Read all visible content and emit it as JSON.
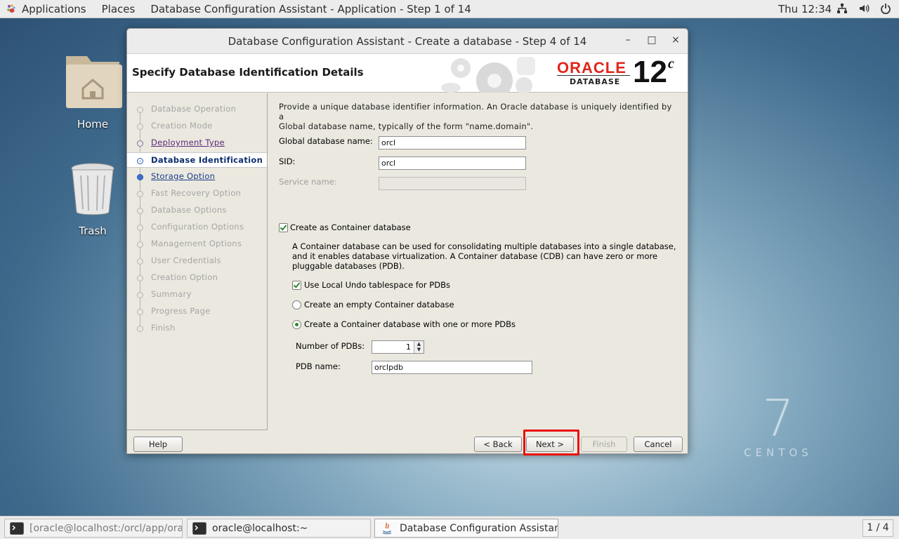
{
  "topbar": {
    "applications": "Applications",
    "places": "Places",
    "active_app": "Database Configuration Assistant - Application - Step 1 of 14",
    "clock": "Thu 12:34"
  },
  "desktop": {
    "home_label": "Home",
    "trash_label": "Trash",
    "centos_seven": "7",
    "centos_word": "CENTOS"
  },
  "window": {
    "title": "Database Configuration Assistant - Create a database - Step 4 of 14",
    "controls": {
      "minimize": "–",
      "maximize": "□",
      "close": "×"
    },
    "heading": "Specify Database Identification Details",
    "logo": {
      "brand": "ORACLE",
      "sub": "DATABASE",
      "version": "12",
      "suffix": "c"
    }
  },
  "nav": {
    "steps": [
      {
        "label": "Database Operation",
        "state": "done"
      },
      {
        "label": "Creation Mode",
        "state": "done"
      },
      {
        "label": "Deployment Type",
        "state": "visited"
      },
      {
        "label": "Database Identification",
        "state": "current"
      },
      {
        "label": "Storage Option",
        "state": "link"
      },
      {
        "label": "Fast Recovery Option",
        "state": "pending"
      },
      {
        "label": "Database Options",
        "state": "pending"
      },
      {
        "label": "Configuration Options",
        "state": "pending"
      },
      {
        "label": "Management Options",
        "state": "pending"
      },
      {
        "label": "User Credentials",
        "state": "pending"
      },
      {
        "label": "Creation Option",
        "state": "pending"
      },
      {
        "label": "Summary",
        "state": "pending"
      },
      {
        "label": "Progress Page",
        "state": "pending"
      },
      {
        "label": "Finish",
        "state": "pending"
      }
    ]
  },
  "form": {
    "intro_line1": "Provide a unique database identifier information. An Oracle database is uniquely identified by a",
    "intro_line2": "Global database name, typically of the form \"name.domain\".",
    "global_db_label": "Global database name:",
    "global_db_value": "orcl",
    "sid_label": "SID:",
    "sid_value": "orcl",
    "service_label": "Service name:",
    "service_value": "",
    "cdb_checkbox_label": "Create as Container database",
    "cdb_checked": true,
    "cdb_desc_line1": "A Container database can be used for consolidating multiple databases into a single database,",
    "cdb_desc_line2": "and it enables database virtualization. A Container database (CDB) can have zero or more",
    "cdb_desc_line3": "pluggable databases (PDB).",
    "undo_label": "Use Local Undo tablespace for PDBs",
    "undo_checked": true,
    "radio_empty_label": "Create an empty Container database",
    "radio_pdbs_label": "Create a Container database with one or more PDBs",
    "selected_radio": "pdbs",
    "num_pdbs_label": "Number of PDBs:",
    "num_pdbs_value": "1",
    "pdb_name_label": "PDB name:",
    "pdb_name_value": "orclpdb"
  },
  "buttons": {
    "help": "Help",
    "back": "< Back",
    "next": "Next >",
    "finish": "Finish",
    "cancel": "Cancel"
  },
  "taskbar": {
    "items": [
      {
        "label": "[oracle@localhost:/orcl/app/oracle/d...",
        "active": false
      },
      {
        "label": "oracle@localhost:~",
        "active": false
      },
      {
        "label": "Database Configuration Assistant - C...",
        "active": true
      }
    ],
    "pager": "1 / 4"
  },
  "colors": {
    "highlight": "#e8120c",
    "oracle_red": "#e2261b",
    "current_step": "#0d2f6e",
    "check_green": "#2c8a2c"
  }
}
